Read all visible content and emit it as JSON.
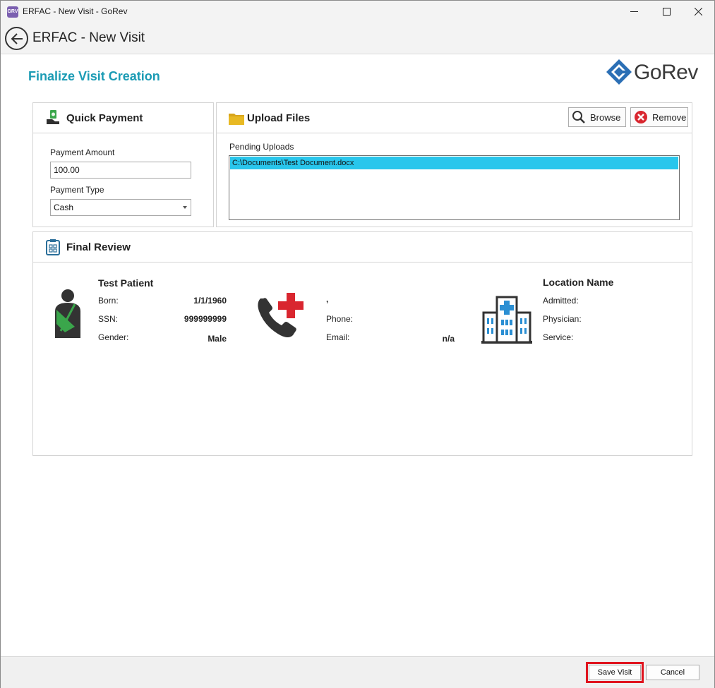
{
  "window": {
    "app_icon_text": "GRV",
    "title": "ERFAC - New Visit - GoRev",
    "controls": [
      "minimize-icon",
      "maximize-icon",
      "close-icon"
    ]
  },
  "header": {
    "back_icon": "arrow-left-icon",
    "title": "ERFAC - New Visit"
  },
  "page": {
    "heading": "Finalize Visit Creation",
    "logo_text": "GoRev",
    "accent_color": "#1b9bb4"
  },
  "quick_payment": {
    "title": "Quick Payment",
    "icon": "cash-hand-icon",
    "amount_label": "Payment Amount",
    "amount_value": "100.00",
    "type_label": "Payment Type",
    "type_value": "Cash"
  },
  "upload_files": {
    "title": "Upload Files",
    "icon": "folder-icon",
    "browse_label": "Browse",
    "remove_label": "Remove",
    "pending_label": "Pending Uploads",
    "pending_files": [
      "C:\\Documents\\Test Document.docx"
    ],
    "selected_color": "#29c6ec"
  },
  "final_review": {
    "title": "Final Review",
    "icon": "clipboard-checklist-icon",
    "patient": {
      "icon": "patient-arm-sling-icon",
      "name": "Test Patient",
      "born_label": "Born:",
      "born_value": "1/1/1960",
      "ssn_label": "SSN:",
      "ssn_value": "999999999",
      "gender_label": "Gender:",
      "gender_value": "Male"
    },
    "contact": {
      "icon": "phone-medical-cross-icon",
      "name_value": ",",
      "phone_label": "Phone:",
      "email_label": "Email:",
      "email_value": "n/a"
    },
    "location": {
      "icon": "hospital-building-icon",
      "name": "Location Name",
      "admitted_label": "Admitted:",
      "physician_label": "Physician:",
      "service_label": "Service:"
    }
  },
  "footer": {
    "save_label": "Save Visit",
    "cancel_label": "Cancel",
    "highlight_color": "#e0141e"
  }
}
